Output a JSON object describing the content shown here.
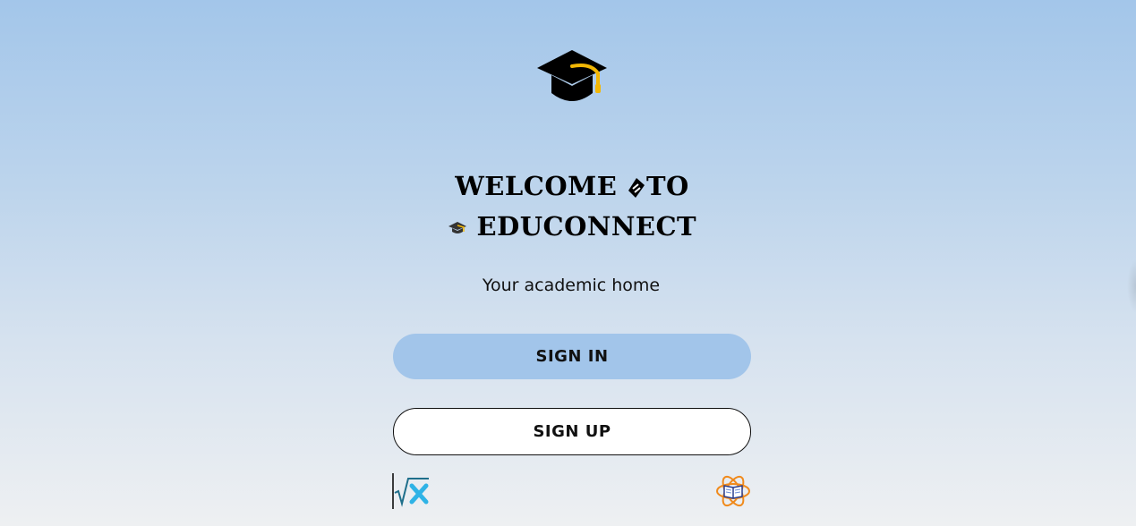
{
  "logo": {
    "icon": "graduation-cap-icon"
  },
  "title": {
    "line1_part1": "WELCOME",
    "line1_icon": "diploma-icon",
    "line1_part2": "TO",
    "line2_icon": "graduation-cap-icon",
    "line2_text": "EDUCONNECT"
  },
  "subtitle": "Your academic home",
  "buttons": {
    "sign_in": "SIGN IN",
    "sign_up": "SIGN UP"
  },
  "footer_icons": {
    "left": "square-root-x-icon",
    "right": "atom-book-icon"
  },
  "colors": {
    "accent": "#a2c5ea",
    "gold": "#f2b705",
    "text": "#000000"
  }
}
